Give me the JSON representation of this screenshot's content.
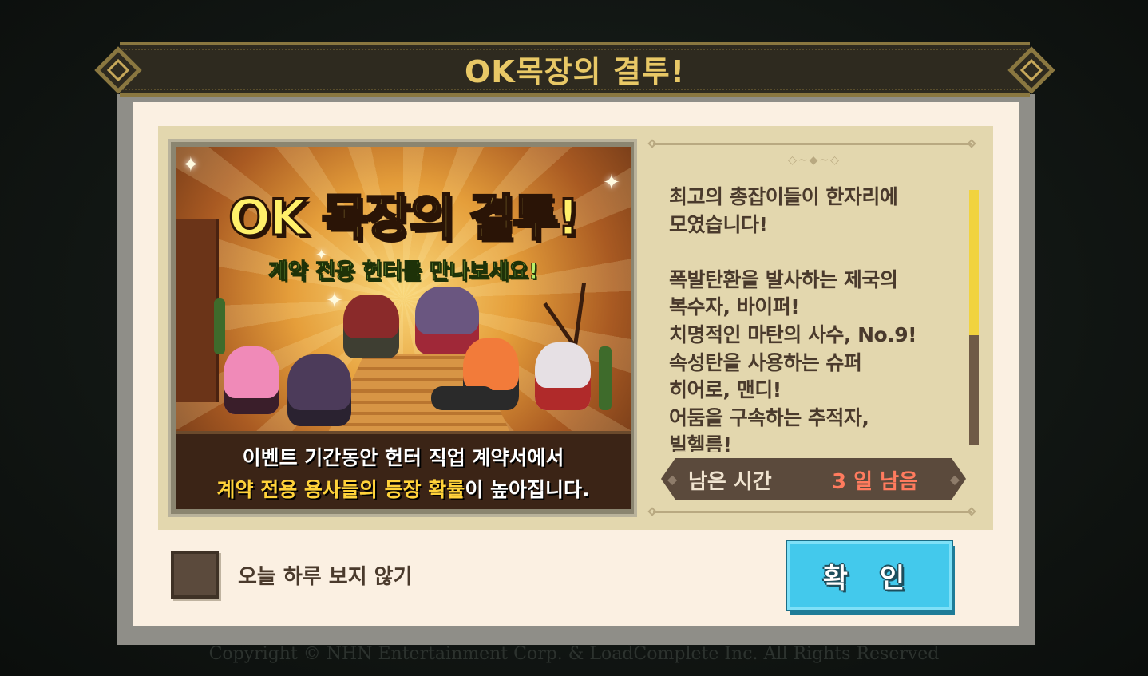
{
  "dialog": {
    "title": "OK목장의 결투!",
    "banner": {
      "title": "OK 목장의 결투!",
      "subtitle": "계약 전용 헌터를 만나보세요!",
      "caption_line1": "이벤트 기간동안 헌터 직업 계약서에서",
      "caption_line2_highlight": "계약 전용 용사들의 등장 확률",
      "caption_line2_rest": "이 높아집니다."
    },
    "description": "최고의 총잡이들이 한자리에\n모였습니다!\n\n폭발탄환을 발사하는 제국의\n복수자, 바이퍼!\n치명적인 마탄의 사수, No.9!\n속성탄을 사용하는 슈퍼\n히어로, 맨디!\n어둠을 구속하는 추적자,\n빌헬름!",
    "scroll": {
      "position_fraction": 0.0,
      "visible_fraction": 0.57
    },
    "remaining": {
      "label": "남은 시간",
      "value": "3 일 남음"
    },
    "dont_show_today_label": "오늘 하루 보지 않기",
    "dont_show_today_checked": false,
    "confirm_label": "확 인"
  },
  "copyright": "Copyright © NHN Entertainment Corp. & LoadComplete Inc. All Rights Reserved",
  "colors": {
    "title_text": "#e8c866",
    "panel_bg": "#e3d7ae",
    "confirm_button": "#43c9ec",
    "remaining_value": "#ff7b5e",
    "scroll_thumb": "#f1d33e"
  },
  "icons": [
    "left-arrow-icon",
    "right-arrow-icon",
    "ornament-icon",
    "sparkle-icon"
  ]
}
